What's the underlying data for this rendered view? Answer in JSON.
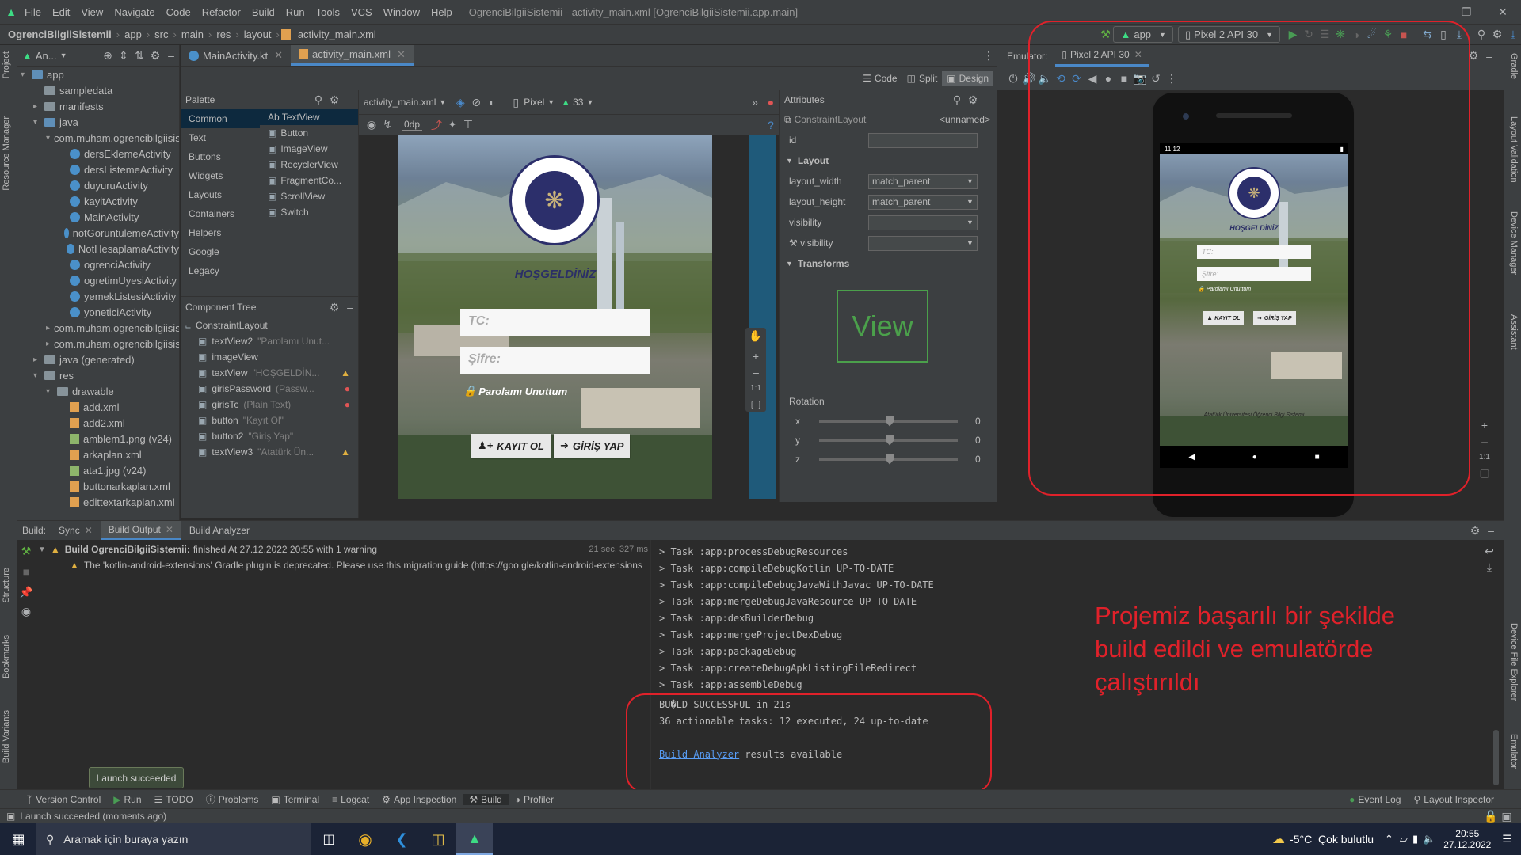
{
  "menu": {
    "items": [
      "File",
      "Edit",
      "View",
      "Navigate",
      "Code",
      "Refactor",
      "Build",
      "Run",
      "Tools",
      "VCS",
      "Window",
      "Help"
    ],
    "window_title": "OgrenciBilgiiSistemii - activity_main.xml [OgrenciBilgiiSistemii.app.main]"
  },
  "nav": {
    "crumbs": [
      "OgrenciBilgiiSistemii",
      "app",
      "src",
      "main",
      "res",
      "layout",
      "activity_main.xml"
    ],
    "run_config": "app",
    "device": "Pixel 2 API 30"
  },
  "project": {
    "header": "An...",
    "tree": [
      {
        "label": "app",
        "indent": 0,
        "kind": "folder-blue",
        "arrow": "v"
      },
      {
        "label": "sampledata",
        "indent": 1,
        "kind": "folder"
      },
      {
        "label": "manifests",
        "indent": 1,
        "kind": "folder",
        "arrow": ">"
      },
      {
        "label": "java",
        "indent": 1,
        "kind": "folder-blue",
        "arrow": "v"
      },
      {
        "label": "com.muham.ogrencibilgiisist",
        "indent": 2,
        "kind": "folder",
        "arrow": "v"
      },
      {
        "label": "dersEklemeActivity",
        "indent": 3,
        "kind": "kt"
      },
      {
        "label": "dersListemeActivity",
        "indent": 3,
        "kind": "kt"
      },
      {
        "label": "duyuruActivity",
        "indent": 3,
        "kind": "kt"
      },
      {
        "label": "kayitActivity",
        "indent": 3,
        "kind": "kt"
      },
      {
        "label": "MainActivity",
        "indent": 3,
        "kind": "kt"
      },
      {
        "label": "notGoruntulemeActivity",
        "indent": 3,
        "kind": "kt"
      },
      {
        "label": "NotHesaplamaActivity",
        "indent": 3,
        "kind": "kt"
      },
      {
        "label": "ogrenciActivity",
        "indent": 3,
        "kind": "kt"
      },
      {
        "label": "ogretimUyesiActivity",
        "indent": 3,
        "kind": "kt"
      },
      {
        "label": "yemekListesiActivity",
        "indent": 3,
        "kind": "kt"
      },
      {
        "label": "yoneticiActivity",
        "indent": 3,
        "kind": "kt"
      },
      {
        "label": "com.muham.ogrencibilgiisist",
        "indent": 2,
        "kind": "folder",
        "arrow": ">"
      },
      {
        "label": "com.muham.ogrencibilgiisist",
        "indent": 2,
        "kind": "folder",
        "arrow": ">"
      },
      {
        "label": "java (generated)",
        "indent": 1,
        "kind": "folder",
        "arrow": ">"
      },
      {
        "label": "res",
        "indent": 1,
        "kind": "folder",
        "arrow": "v"
      },
      {
        "label": "drawable",
        "indent": 2,
        "kind": "folder",
        "arrow": "v"
      },
      {
        "label": "add.xml",
        "indent": 3,
        "kind": "xml"
      },
      {
        "label": "add2.xml",
        "indent": 3,
        "kind": "xml"
      },
      {
        "label": "amblem1.png (v24)",
        "indent": 3,
        "kind": "img"
      },
      {
        "label": "arkaplan.xml",
        "indent": 3,
        "kind": "xml"
      },
      {
        "label": "ata1.jpg (v24)",
        "indent": 3,
        "kind": "img"
      },
      {
        "label": "buttonarkaplan.xml",
        "indent": 3,
        "kind": "xml"
      },
      {
        "label": "edittextarkaplan.xml",
        "indent": 3,
        "kind": "xml"
      }
    ]
  },
  "editor": {
    "tabs": [
      "MainActivity.kt",
      "activity_main.xml"
    ],
    "view_modes": [
      "Code",
      "Split",
      "Design"
    ]
  },
  "palette": {
    "title": "Palette",
    "categories": [
      "Common",
      "Text",
      "Buttons",
      "Widgets",
      "Layouts",
      "Containers",
      "Helpers",
      "Google",
      "Legacy"
    ],
    "widgets": [
      "Ab TextView",
      "Button",
      "ImageView",
      "RecyclerView",
      "FragmentCo...",
      "ScrollView",
      "Switch"
    ]
  },
  "component_tree": {
    "title": "Component Tree",
    "items": [
      {
        "label": "ConstraintLayout",
        "hint": "",
        "status": ""
      },
      {
        "label": "textView2",
        "hint": "\"Parolamı Unut...",
        "status": ""
      },
      {
        "label": "imageView",
        "hint": "",
        "status": ""
      },
      {
        "label": "textView",
        "hint": "\"HOŞGELDİN...",
        "status": "warn"
      },
      {
        "label": "girisPassword",
        "hint": "(Passw...",
        "status": "err"
      },
      {
        "label": "girisTc",
        "hint": "(Plain Text)",
        "status": "err"
      },
      {
        "label": "button",
        "hint": "\"Kayıt Ol\"",
        "status": ""
      },
      {
        "label": "button2",
        "hint": "\"Giriş Yap\"",
        "status": ""
      },
      {
        "label": "textView3",
        "hint": "\"Atatürk Ün...",
        "status": "warn"
      }
    ]
  },
  "design_toolbar": {
    "file": "activity_main.xml",
    "device": "Pixel",
    "api": "33",
    "margin": "0dp"
  },
  "design_preview": {
    "welcome": "HOŞGELDİNİZ",
    "tc_hint": "TC:",
    "password_hint": "Şifre:",
    "forgot": "Parolamı Unuttum",
    "register": "KAYIT OL",
    "login": "GİRİŞ YAP",
    "footer": "Atatürk Üniversitesi Öğrenci Bilgi Sistemi"
  },
  "attributes": {
    "title": "Attributes",
    "component": "ConstraintLayout",
    "name": "<unnamed>",
    "id_label": "id",
    "layout_section": "Layout",
    "layout_width_label": "layout_width",
    "layout_width": "match_parent",
    "layout_height_label": "layout_height",
    "layout_height": "match_parent",
    "visibility_label": "visibility",
    "visibility2_label": "visibility",
    "transforms_section": "Transforms",
    "view_word": "View",
    "rotation_label": "Rotation",
    "axes": [
      {
        "name": "x",
        "value": "0"
      },
      {
        "name": "y",
        "value": "0"
      },
      {
        "name": "z",
        "value": "0"
      }
    ]
  },
  "emulator": {
    "label": "Emulator:",
    "tab": "Pixel 2 API 30",
    "status_time": "11:12",
    "zoom_label": "1:1"
  },
  "build": {
    "label": "Build:",
    "tabs": [
      "Sync",
      "Build Output",
      "Build Analyzer"
    ],
    "summary_project": "Build OgrenciBilgiiSistemii:",
    "summary_rest": "finished At 27.12.2022 20:55 with 1 warning",
    "duration": "21 sec, 327 ms",
    "warning": "The 'kotlin-android-extensions' Gradle plugin is deprecated. Please use this migration guide (https://goo.gle/kotlin-android-extensions",
    "log": [
      "> Task :app:processDebugResources",
      "> Task :app:compileDebugKotlin UP-TO-DATE",
      "> Task :app:compileDebugJavaWithJavac UP-TO-DATE",
      "> Task :app:mergeDebugJavaResource UP-TO-DATE",
      "> Task :app:dexBuilderDebug",
      "> Task :app:mergeProjectDexDebug",
      "> Task :app:packageDebug",
      "> Task :app:createDebugApkListingFileRedirect",
      "> Task :app:assembleDebug"
    ],
    "success": "BU�LD SUCCESSFUL in 21s",
    "tasks": "36 actionable tasks: 12 executed, 24 up-to-date",
    "analyzer_link": "Build Analyzer",
    "analyzer_rest": " results available"
  },
  "annotation": "Projemiz başarılı bir şekilde build edildi ve emulatörde çalıştırıldı",
  "tooltip": "Launch succeeded",
  "bottom_tools": [
    "Version Control",
    "Run",
    "TODO",
    "Problems",
    "Terminal",
    "Logcat",
    "App Inspection",
    "Build",
    "Profiler"
  ],
  "bottom_right": [
    "Event Log",
    "Layout Inspector"
  ],
  "status": "Launch succeeded (moments ago)",
  "left_tabs": [
    "Project",
    "Resource Manager",
    "Structure",
    "Bookmarks",
    "Build Variants"
  ],
  "right_tabs": [
    "Gradle",
    "Layout Validation",
    "Device Manager",
    "Assistant",
    "Device File Explorer",
    "Emulator"
  ],
  "taskbar": {
    "search": "Aramak için buraya yazın",
    "weather": "-5°C  Çok bulutlu",
    "time": "20:55",
    "date": "27.12.2022"
  },
  "colors": {
    "accent": "#4a88c7",
    "annotation": "#e0212a",
    "success": "#499c54"
  }
}
